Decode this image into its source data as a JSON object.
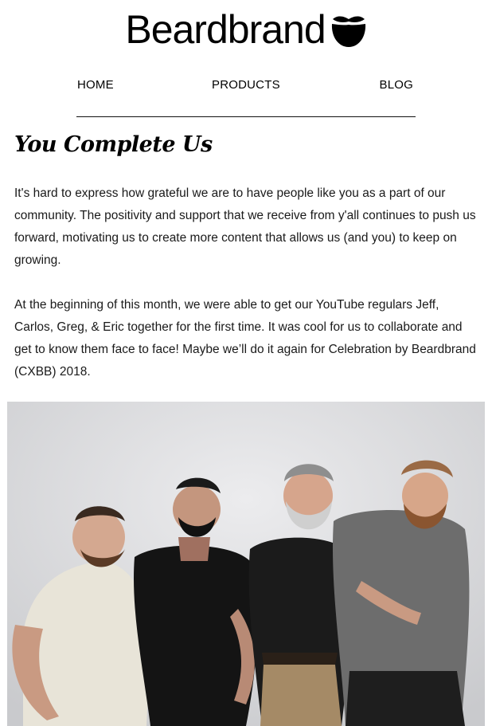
{
  "brand": {
    "name": "Beardbrand",
    "logo_icon": "beard-icon"
  },
  "nav": {
    "home": "HOME",
    "products": "PRODUCTS",
    "blog": "BLOG"
  },
  "article": {
    "title": "You Complete Us",
    "paragraphs": [
      "It's hard to express how grateful we are to have people like you as a part of our community. The positivity and support that we receive from y'all continues to push us forward, motivating us to create more content that allows us (and you) to keep on growing.",
      "At the beginning of this month, we were able to get our YouTube regulars Jeff, Carlos, Greg, & Eric together for the first time. It was cool for us to collaborate and get to know them face to face! Maybe we’ll do it again for Celebration by Beardbrand (CXBB) 2018."
    ]
  },
  "colors": {
    "text": "#111111",
    "background": "#ffffff",
    "photo_backdrop": "#dcdde0"
  }
}
